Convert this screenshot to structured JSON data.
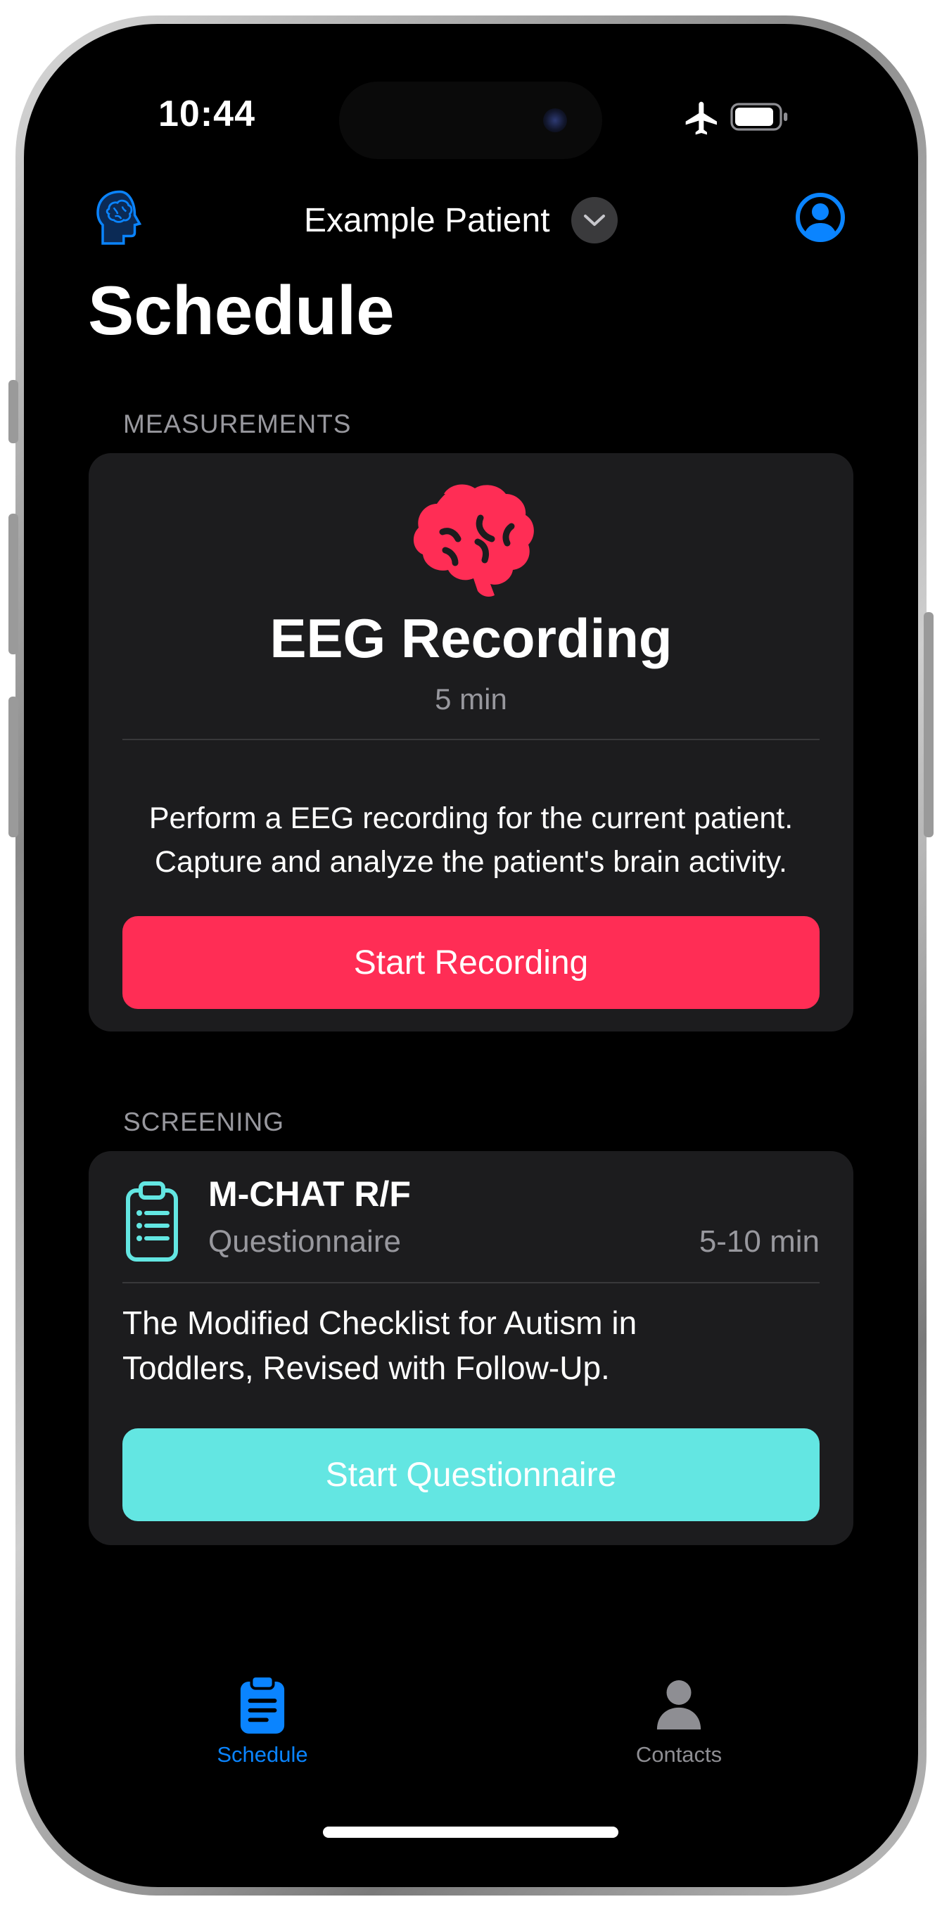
{
  "status_bar": {
    "time": "10:44"
  },
  "nav": {
    "patient_name": "Example Patient"
  },
  "page": {
    "title": "Schedule"
  },
  "sections": {
    "measurements": {
      "header": "MEASUREMENTS",
      "card": {
        "title": "EEG Recording",
        "duration": "5 min",
        "description_line1": "Perform a EEG recording for the current patient.",
        "description_line2": "Capture and analyze the patient's brain activity.",
        "button_label": "Start Recording"
      }
    },
    "screening": {
      "header": "SCREENING",
      "card": {
        "title": "M-CHAT R/F",
        "subtitle": "Questionnaire",
        "duration": "5-10 min",
        "description_line1": "The Modified Checklist for Autism in",
        "description_line2": "Toddlers, Revised with Follow-Up.",
        "button_label": "Start Questionnaire"
      }
    }
  },
  "tabs": [
    {
      "label": "Schedule",
      "icon": "clipboard-icon",
      "selected": true
    },
    {
      "label": "Contacts",
      "icon": "person-icon",
      "selected": false
    }
  ],
  "colors": {
    "accent_blue": "#0a84ff",
    "eeg_pink": "#ff2d55",
    "screening_teal": "#63e6e2",
    "card_background": "#1c1c1e",
    "secondary_text": "#98989e"
  }
}
